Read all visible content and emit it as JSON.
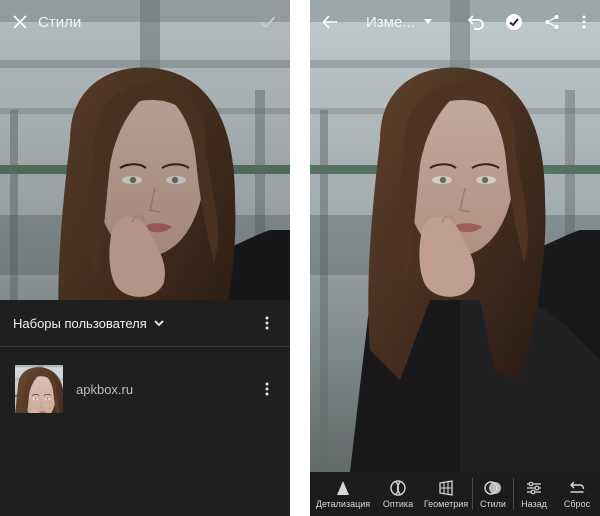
{
  "left_screen": {
    "topbar": {
      "title": "Стили",
      "close_icon": "close-icon",
      "confirm_icon": "check-icon"
    },
    "panel": {
      "header_label": "Наборы пользователя",
      "preset_name": "apkbox.ru"
    }
  },
  "right_screen": {
    "topbar": {
      "title": "Изме...",
      "back_icon": "arrow-left-icon",
      "undo_icon": "undo-icon",
      "apply_icon": "check-circle-icon",
      "share_icon": "share-icon",
      "more_icon": "more-vertical-icon"
    },
    "toolbar": {
      "items": [
        {
          "label": "Детализация",
          "icon": "triangle-icon"
        },
        {
          "label": "Оптика",
          "icon": "lens-icon"
        },
        {
          "label": "Геометрия",
          "icon": "grid-icon"
        },
        {
          "label": "Стили",
          "icon": "styles-icon"
        },
        {
          "label": "Назад",
          "icon": "sliders-icon"
        },
        {
          "label": "Сброс",
          "icon": "reset-icon"
        }
      ]
    }
  },
  "colors": {
    "panel_bg": "#1f1f1f",
    "toolbar_bg": "#1c1c1c",
    "text_primary": "#f2f2f2",
    "text_secondary": "#bfbfbf"
  }
}
